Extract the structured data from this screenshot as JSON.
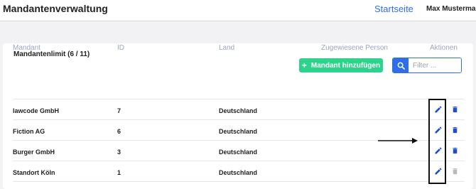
{
  "app": {
    "title": "Mandantenverwaltung"
  },
  "nav": {
    "home_link": "Startseite",
    "user_name": "Max Mustermann"
  },
  "panel": {
    "limit_text": "Mandantenlimit (6 / 11)",
    "add_button_icon": "+",
    "add_button_label": "Mandant hinzufügen",
    "search_placeholder": "Filter ...",
    "search_value": ""
  },
  "table": {
    "columns": [
      "Mandant",
      "ID",
      "Land",
      "Zugewiesene Person",
      "Aktionen"
    ],
    "rows": [
      {
        "name": "lawcode GmbH",
        "id": "7",
        "country": "Deutschland",
        "person": "",
        "delete_enabled": true
      },
      {
        "name": "Fiction AG",
        "id": "6",
        "country": "Deutschland",
        "person": "",
        "delete_enabled": true
      },
      {
        "name": "Burger GmbH",
        "id": "3",
        "country": "Deutschland",
        "person": "",
        "delete_enabled": true
      },
      {
        "name": "Standort Köln",
        "id": "1",
        "country": "Deutschland",
        "person": "",
        "delete_enabled": false
      }
    ]
  },
  "colors": {
    "accent_blue": "#2f6ee6",
    "add_green": "#2ed38b",
    "edit_icon": "#1f4fc9",
    "delete_icon": "#1f4fc9",
    "delete_disabled": "#b9b9b9",
    "header_text": "#9aa6bd"
  },
  "icons": {
    "search": "search-icon",
    "edit": "pencil-icon",
    "delete": "trash-icon",
    "add": "plus-icon"
  }
}
